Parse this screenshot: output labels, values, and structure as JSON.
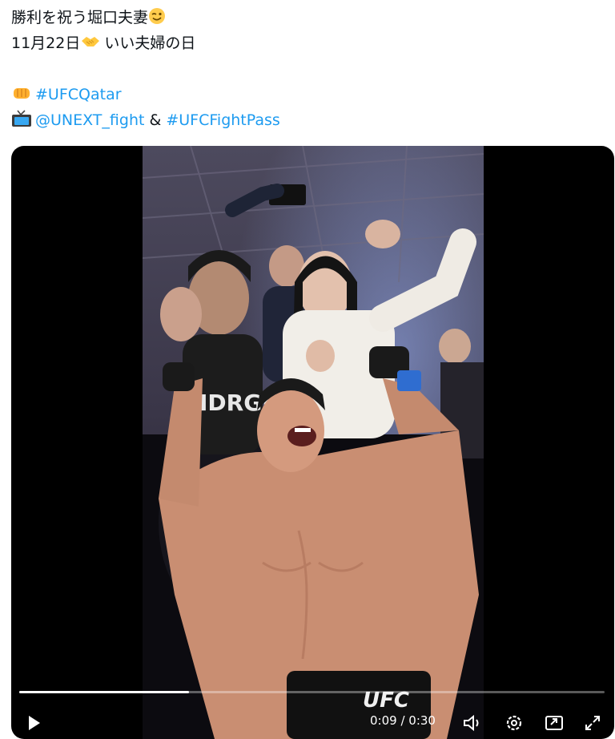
{
  "tweet": {
    "line1": "勝利を祝う堀口夫妻",
    "line2_date": "11月22日",
    "line2_text": "いい夫婦の日",
    "hashtag1": "#UFCQatar",
    "mention": "@UNEXT_fight",
    "amp": "&",
    "hashtag2": "#UFCFightPass",
    "icons": [
      "wink-emoji",
      "handshake-emoji",
      "fist-emoji",
      "tv-emoji"
    ]
  },
  "video": {
    "shorts_text": "UFC",
    "progress": 0.29,
    "time_display": "0:09 / 0:30",
    "controls": [
      "play-icon",
      "volume-icon",
      "settings-icon",
      "pip-icon",
      "fullscreen-icon"
    ]
  },
  "colors": {
    "link": "#1d9bf0",
    "text": "#0f1419",
    "media_bg": "#000000"
  }
}
